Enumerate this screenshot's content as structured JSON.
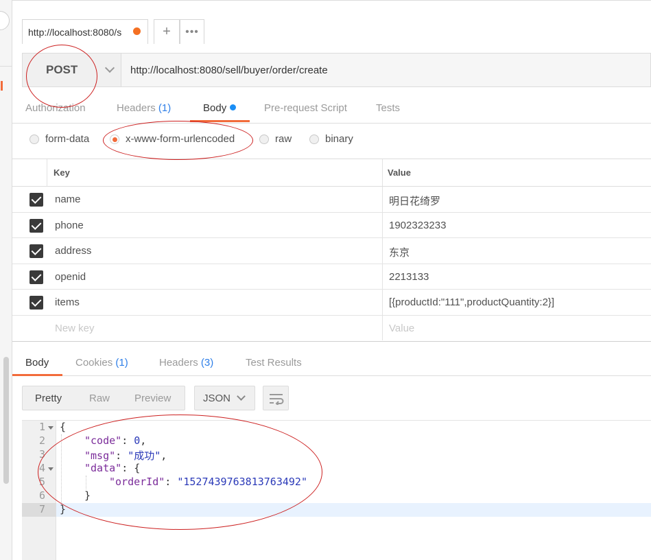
{
  "tabs": [
    {
      "label": "http://localhost:8080/s"
    },
    {
      "label": "+"
    },
    {
      "label": "•••"
    }
  ],
  "request": {
    "method": "POST",
    "url": "http://localhost:8080/sell/buyer/order/create"
  },
  "request_tabs": {
    "authorization": "Authorization",
    "headers": "Headers",
    "headers_count": "(1)",
    "body": "Body",
    "pre_request": "Pre-request Script",
    "tests": "Tests"
  },
  "body_types": {
    "form_data": "form-data",
    "urlencoded": "x-www-form-urlencoded",
    "raw": "raw",
    "binary": "binary",
    "selected": "x-www-form-urlencoded"
  },
  "kv_table": {
    "key_header": "Key",
    "value_header": "Value",
    "rows": [
      {
        "key": "name",
        "value": "明日花绮罗"
      },
      {
        "key": "phone",
        "value": "1902323233"
      },
      {
        "key": "address",
        "value": "东京"
      },
      {
        "key": "openid",
        "value": "2213133"
      },
      {
        "key": "items",
        "value": "[{productId:\"111\",productQuantity:2}]"
      }
    ],
    "new_key_placeholder": "New key",
    "new_value_placeholder": "Value"
  },
  "response_tabs": {
    "body": "Body",
    "cookies": "Cookies",
    "cookies_count": "(1)",
    "headers": "Headers",
    "headers_count": "(3)",
    "test_results": "Test Results"
  },
  "view_modes": {
    "pretty": "Pretty",
    "raw": "Raw",
    "preview": "Preview",
    "format": "JSON"
  },
  "response_code": {
    "line_numbers": [
      "1",
      "2",
      "3",
      "4",
      "5",
      "6",
      "7"
    ],
    "open_brace": "{",
    "code_key": "\"code\"",
    "code_value": "0",
    "msg_key": "\"msg\"",
    "msg_value": "\"成功\"",
    "data_key": "\"data\"",
    "data_open": "{",
    "order_key": "\"orderId\"",
    "order_value": "\"1527439763813763492\"",
    "inner_close": "}",
    "outer_close": "}"
  },
  "colors": {
    "accent_orange": "#f26b3a",
    "count_blue": "#2d7ee8",
    "annotation_red": "#cc1f1f"
  }
}
